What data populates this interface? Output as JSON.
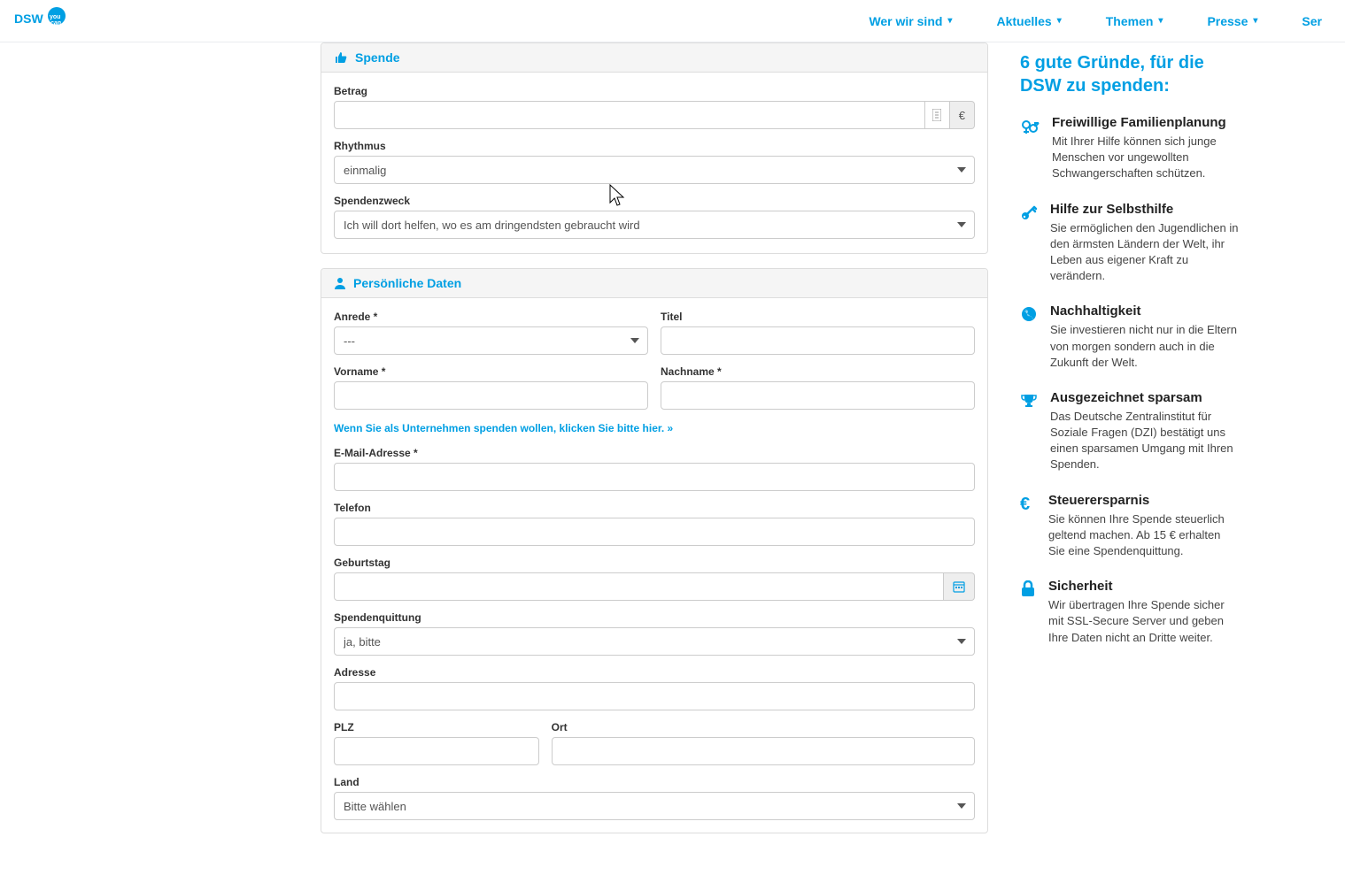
{
  "header": {
    "logo_alt": "DSW you can",
    "nav": [
      "Wer wir sind",
      "Aktuelles",
      "Themen",
      "Presse",
      "Ser"
    ]
  },
  "spende": {
    "section_title": "Spende",
    "betrag_label": "Betrag",
    "betrag_value": "",
    "currency": "€",
    "rhythm_label": "Rhythmus",
    "rhythm_value": "einmalig",
    "purpose_label": "Spendenzweck",
    "purpose_value": "Ich will dort helfen, wo es am dringendsten gebraucht wird"
  },
  "personal": {
    "section_title": "Persönliche Daten",
    "anrede_label": "Anrede *",
    "anrede_value": "---",
    "titel_label": "Titel",
    "vorname_label": "Vorname *",
    "nachname_label": "Nachname *",
    "company_link": "Wenn Sie als Unternehmen spenden wollen, klicken Sie bitte hier. »",
    "email_label": "E-Mail-Adresse *",
    "telefon_label": "Telefon",
    "geburtstag_label": "Geburtstag",
    "receipt_label": "Spendenquittung",
    "receipt_value": "ja, bitte",
    "adresse_label": "Adresse",
    "plz_label": "PLZ",
    "ort_label": "Ort",
    "land_label": "Land",
    "land_value": "Bitte wählen"
  },
  "sidebar": {
    "title": "6 gute Gründe, für die DSW zu spenden:",
    "reasons": [
      {
        "title": "Freiwillige Familienplanung",
        "text": "Mit Ihrer Hilfe können sich junge Menschen vor ungewollten Schwangerschaften schützen."
      },
      {
        "title": "Hilfe zur Selbsthilfe",
        "text": "Sie ermöglichen den Jugendlichen in den ärmsten Ländern der Welt, ihr Leben aus eigener Kraft zu verändern."
      },
      {
        "title": "Nachhaltigkeit",
        "text": "Sie investieren nicht nur in die Eltern von morgen sondern auch in die Zukunft der Welt."
      },
      {
        "title": "Ausgezeichnet sparsam",
        "text": "Das Deutsche Zentralinstitut für Soziale Fragen (DZI) bestätigt uns einen sparsamen Umgang mit Ihren Spenden."
      },
      {
        "title": "Steuerersparnis",
        "text": "Sie können Ihre Spende steuerlich geltend machen. Ab 15 € erhalten Sie eine Spendenquittung."
      },
      {
        "title": "Sicherheit",
        "text": "Wir übertragen Ihre Spende sicher mit SSL-Secure Server und geben Ihre Daten nicht an Dritte weiter."
      }
    ]
  }
}
